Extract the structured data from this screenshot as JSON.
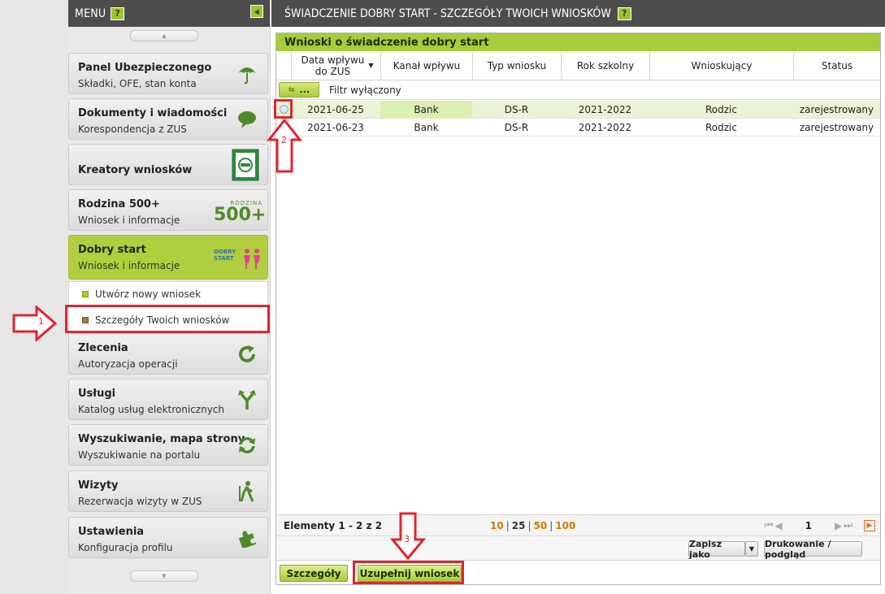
{
  "sidebar": {
    "menu_title": "MENU",
    "help": "?",
    "tiles": [
      {
        "title": "Panel Ubezpieczonego",
        "subtitle": "Składki, OFE, stan konta"
      },
      {
        "title": "Dokumenty i wiadomości",
        "subtitle": "Korespondencja z ZUS"
      },
      {
        "title": "Kreatory wniosków",
        "subtitle": ""
      },
      {
        "title": "Rodzina 500+",
        "subtitle": "Wniosek i informacje"
      },
      {
        "title": "Dobry start",
        "subtitle": "Wniosek i informacje"
      },
      {
        "title": "Zlecenia",
        "subtitle": "Autoryzacja operacji"
      },
      {
        "title": "Usługi",
        "subtitle": "Katalog usług elektronicznych"
      },
      {
        "title": "Wyszukiwanie, mapa strony",
        "subtitle": "Wyszukiwanie na portalu"
      },
      {
        "title": "Wizyty",
        "subtitle": "Rezerwacja wizyty w ZUS"
      },
      {
        "title": "Ustawienia",
        "subtitle": "Konfiguracja profilu"
      }
    ],
    "rodzina_logo": "500+",
    "rodzina_logo_small": "RODZINA",
    "dobry_logo": "DOBRY START",
    "submenu": [
      {
        "label": "Utwórz nowy wniosek"
      },
      {
        "label": "Szczegóły Twoich wniosków"
      }
    ]
  },
  "main": {
    "title": "ŚWIADCZENIE DOBRY START - SZCZEGÓŁY TWOICH WNIOSKÓW",
    "help": "?",
    "panel_title": "Wnioski o świadczenie dobry start",
    "columns": [
      "Data wpływu do ZUS",
      "Kanał wpływu",
      "Typ wniosku",
      "Rok szkolny",
      "Wnioskujący",
      "Status"
    ],
    "filter_button": "...",
    "filter_text": "Filtr wyłączony",
    "rows": [
      [
        "2021-06-25",
        "Bank",
        "DS-R",
        "2021-2022",
        "Rodzic",
        "zarejestrowany"
      ],
      [
        "2021-06-23",
        "Bank",
        "DS-R",
        "2021-2022",
        "Rodzic",
        "zarejestrowany"
      ]
    ],
    "pager": {
      "elements": "Elementy 1 - 2 z 2",
      "sizes": [
        "10",
        "25",
        "50",
        "100"
      ],
      "current_size": "25",
      "page": "1"
    },
    "save_as": "Zapisz jako",
    "print": "Drukowanie / podgląd",
    "details_button": "Szczegóły",
    "complete_button": "Uzupełnij wniosek"
  },
  "annotations": {
    "one": "1",
    "two": "2",
    "three": "3"
  },
  "colors": {
    "accent_green": "#a7cc3c",
    "header_dark": "#4d4d4d",
    "annotation_red": "#e0252f"
  }
}
